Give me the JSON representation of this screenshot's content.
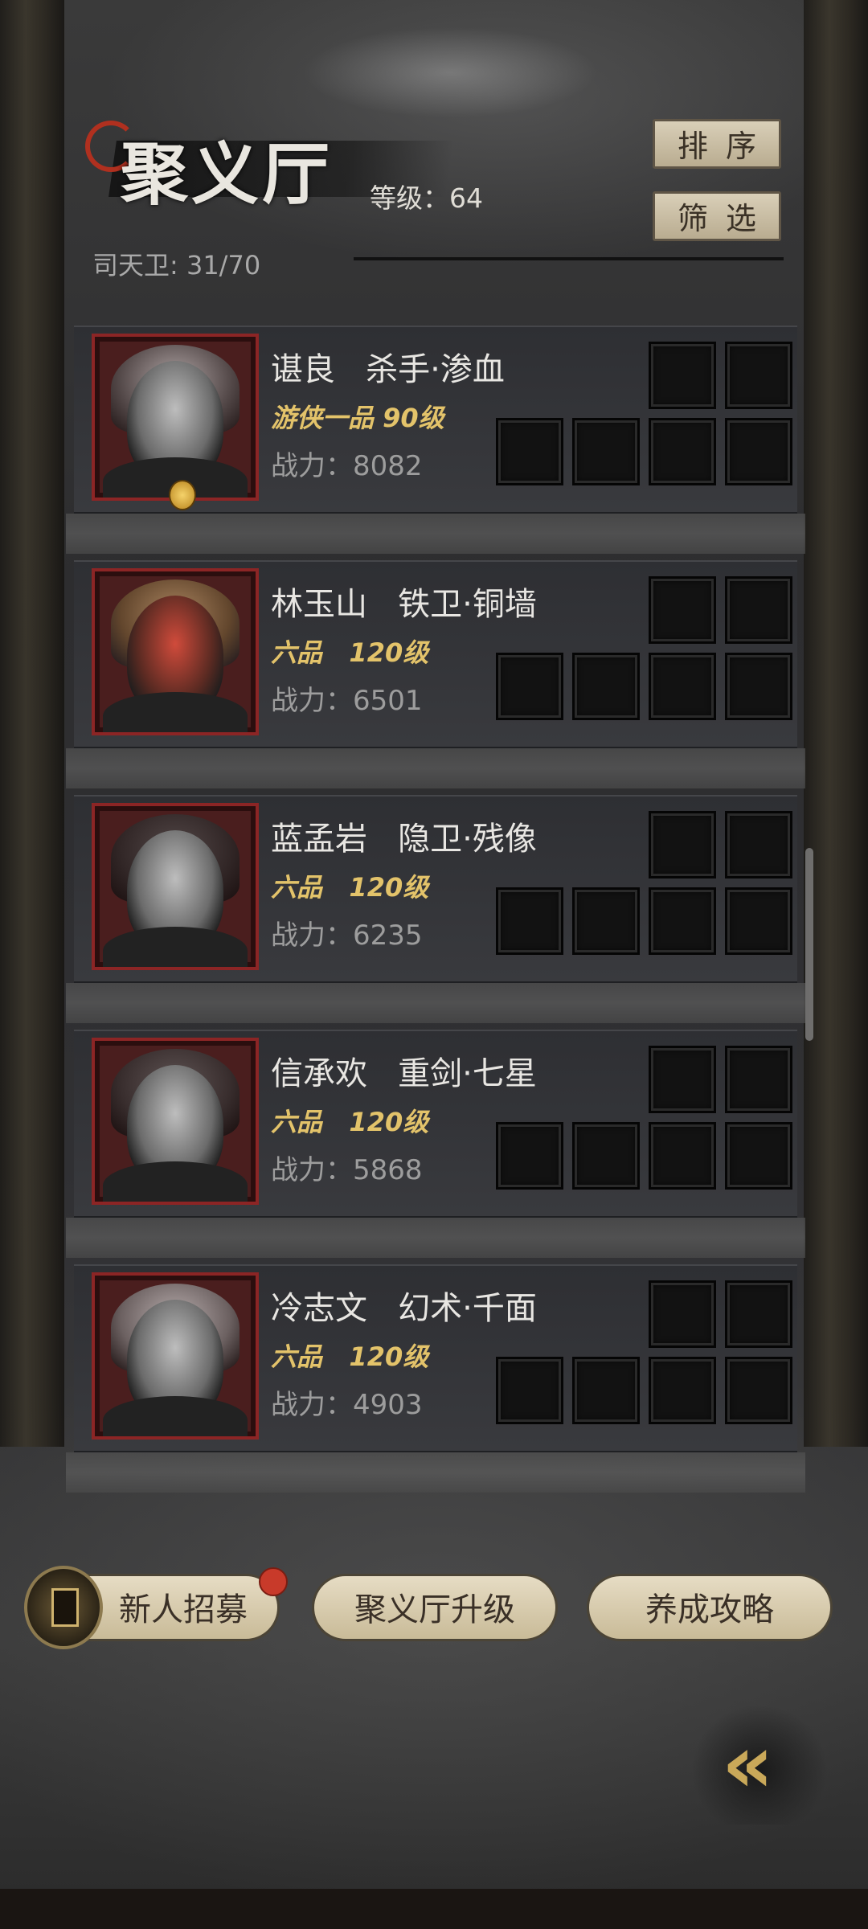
{
  "header": {
    "title": "聚义厅",
    "level_text": "等级：64",
    "guard_count": "司天卫: 31/70"
  },
  "top_buttons": {
    "sort_label": "排序",
    "filter_label": "筛选"
  },
  "heroes": [
    {
      "name_line": "谌良   杀手·渗血",
      "grade_line": "游侠一品 90级",
      "power_line": "战力：8082"
    },
    {
      "name_line": "林玉山   铁卫·铜墙",
      "grade_line": "六品   120级",
      "power_line": "战力：6501"
    },
    {
      "name_line": "蓝孟岩   隐卫·残像",
      "grade_line": "六品   120级",
      "power_line": "战力：6235"
    },
    {
      "name_line": "信承欢   重剑·七星",
      "grade_line": "六品   120级",
      "power_line": "战力：5868"
    },
    {
      "name_line": "冷志文   幻术·千面",
      "grade_line": "六品   120级",
      "power_line": "战力：4903"
    }
  ],
  "bottom_buttons": {
    "recruit_label": "新人招募",
    "upgrade_label": "聚义厅升级",
    "guide_label": "养成攻略"
  },
  "back_button": {
    "label": "«"
  },
  "colors": {
    "accent_gold": "#e3c36a",
    "portrait_border": "#8c2525",
    "button_beige": "#d9cfb8"
  }
}
